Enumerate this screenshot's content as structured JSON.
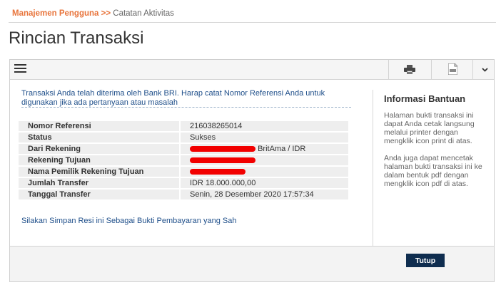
{
  "breadcrumb": {
    "parent": "Manajemen Pengguna",
    "separator": ">>",
    "current": "Catatan Aktivitas"
  },
  "page_title": "Rincian Transaksi",
  "toolbar": {
    "icons": [
      "menu-icon",
      "printer-icon",
      "pdf-icon",
      "chevron-down-icon"
    ]
  },
  "notice": "Transaksi Anda telah diterima oleh Bank BRI. Harap catat Nomor Referensi Anda untuk digunakan jika ada pertanyaan atau masalah",
  "details": {
    "nomor_referensi": {
      "label": "Nomor Referensi",
      "value": "216038265014"
    },
    "status": {
      "label": "Status",
      "value": "Sukses"
    },
    "dari_rekening": {
      "label": "Dari Rekening",
      "suffix": "BritAma / IDR"
    },
    "rekening_tujuan": {
      "label": "Rekening Tujuan"
    },
    "nama_pemilik": {
      "label": "Nama Pemilik Rekening Tujuan"
    },
    "jumlah_transfer": {
      "label": "Jumlah Transfer",
      "value": "IDR 18.000.000,00"
    },
    "tanggal_transfer": {
      "label": "Tanggal Transfer",
      "value": "Senin, 28 Desember 2020 17:57:34"
    }
  },
  "save_note": "Silakan Simpan Resi ini Sebagai Bukti Pembayaran yang Sah",
  "help": {
    "title": "Informasi Bantuan",
    "paragraph1": "Halaman bukti transaksi ini dapat Anda cetak langsung melalui printer dengan mengklik icon print di atas.",
    "paragraph2": "Anda juga dapat mencetak halaman bukti transaksi ini ke dalam bentuk pdf dengan mengklik icon pdf di atas."
  },
  "buttons": {
    "close_label": "Tutup"
  },
  "colors": {
    "breadcrumb_accent": "#e8743b",
    "link_text": "#1f4f8a",
    "button_bg": "#0f2d4f",
    "redaction": "#f20000"
  }
}
